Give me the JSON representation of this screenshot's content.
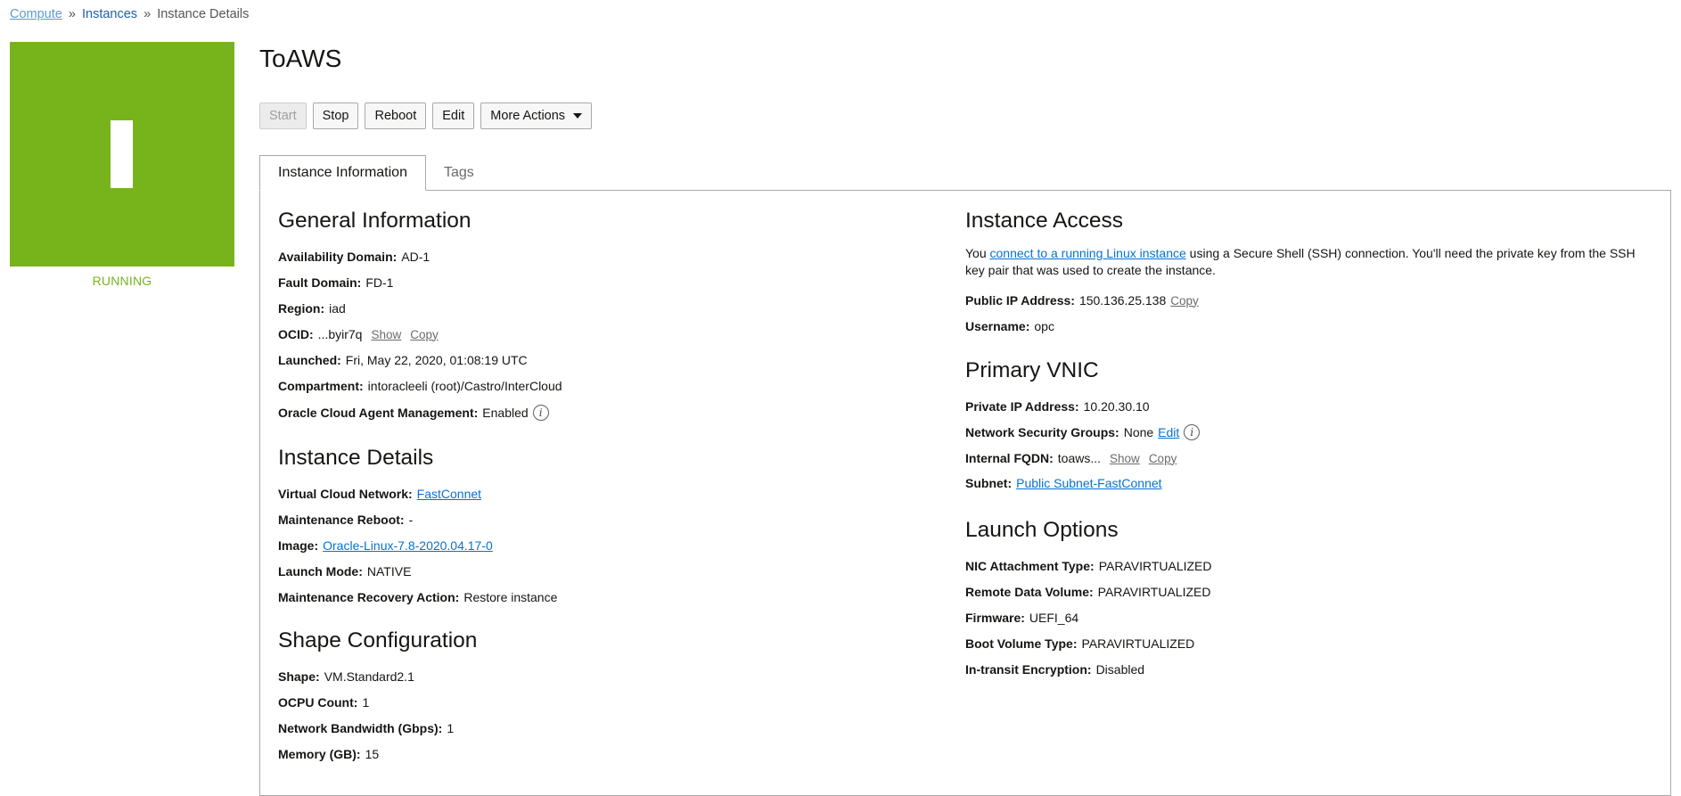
{
  "breadcrumb": {
    "compute": "Compute",
    "sep1": "»",
    "instances": "Instances",
    "sep2": "»",
    "current": "Instance Details"
  },
  "status": {
    "label": "RUNNING",
    "color": "#77b41c"
  },
  "title": "ToAWS",
  "actions": {
    "start": "Start",
    "stop": "Stop",
    "reboot": "Reboot",
    "edit": "Edit",
    "more": "More Actions"
  },
  "tabs": {
    "info": "Instance Information",
    "tags": "Tags"
  },
  "general": {
    "title": "General Information",
    "availability_domain": {
      "label": "Availability Domain:",
      "value": "AD-1"
    },
    "fault_domain": {
      "label": "Fault Domain:",
      "value": "FD-1"
    },
    "region": {
      "label": "Region:",
      "value": "iad"
    },
    "ocid": {
      "label": "OCID:",
      "value": "...byir7q",
      "show": "Show",
      "copy": "Copy"
    },
    "launched": {
      "label": "Launched:",
      "value": "Fri, May 22, 2020, 01:08:19 UTC"
    },
    "compartment": {
      "label": "Compartment:",
      "value": "intoracleeli (root)/Castro/InterCloud"
    },
    "agent": {
      "label": "Oracle Cloud Agent Management:",
      "value": "Enabled",
      "info_icon": "i"
    }
  },
  "details": {
    "title": "Instance Details",
    "vcn": {
      "label": "Virtual Cloud Network:",
      "value": "FastConnet"
    },
    "maintenance_reboot": {
      "label": "Maintenance Reboot:",
      "value": "-"
    },
    "image": {
      "label": "Image:",
      "value": "Oracle-Linux-7.8-2020.04.17-0"
    },
    "launch_mode": {
      "label": "Launch Mode:",
      "value": "NATIVE"
    },
    "recovery": {
      "label": "Maintenance Recovery Action:",
      "value": "Restore instance"
    }
  },
  "shape": {
    "title": "Shape Configuration",
    "shape": {
      "label": "Shape:",
      "value": "VM.Standard2.1"
    },
    "ocpu": {
      "label": "OCPU Count:",
      "value": "1"
    },
    "bandwidth": {
      "label": "Network Bandwidth (Gbps):",
      "value": "1"
    },
    "memory": {
      "label": "Memory (GB):",
      "value": "15"
    }
  },
  "access": {
    "title": "Instance Access",
    "para_before": "You ",
    "para_link": "connect to a running Linux instance",
    "para_after": " using a Secure Shell (SSH) connection. You'll need the private key from the SSH key pair that was used to create the instance.",
    "public_ip": {
      "label": "Public IP Address:",
      "value": "150.136.25.138",
      "copy": "Copy"
    },
    "username": {
      "label": "Username:",
      "value": "opc"
    }
  },
  "vnic": {
    "title": "Primary VNIC",
    "private_ip": {
      "label": "Private IP Address:",
      "value": "10.20.30.10"
    },
    "nsg": {
      "label": "Network Security Groups:",
      "value": "None",
      "edit": "Edit",
      "info_icon": "i"
    },
    "fqdn": {
      "label": "Internal FQDN:",
      "value": "toaws...",
      "show": "Show",
      "copy": "Copy"
    },
    "subnet": {
      "label": "Subnet:",
      "value": "Public Subnet-FastConnet"
    }
  },
  "launch": {
    "title": "Launch Options",
    "nic": {
      "label": "NIC Attachment Type:",
      "value": "PARAVIRTUALIZED"
    },
    "remote_volume": {
      "label": "Remote Data Volume:",
      "value": "PARAVIRTUALIZED"
    },
    "firmware": {
      "label": "Firmware:",
      "value": "UEFI_64"
    },
    "boot_volume": {
      "label": "Boot Volume Type:",
      "value": "PARAVIRTUALIZED"
    },
    "encryption": {
      "label": "In-transit Encryption:",
      "value": "Disabled"
    }
  }
}
